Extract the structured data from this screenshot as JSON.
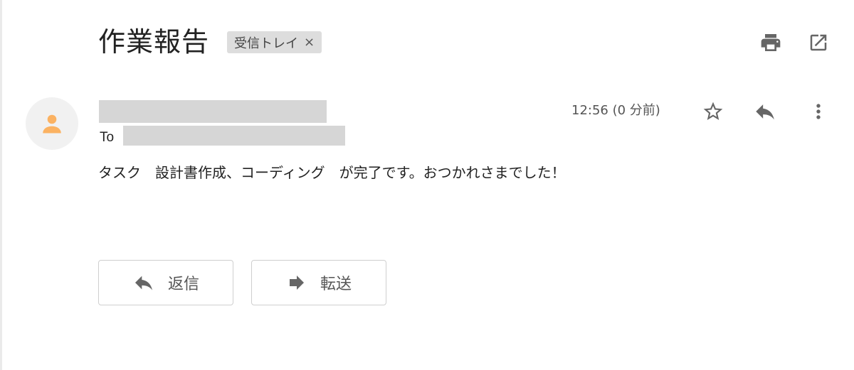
{
  "email": {
    "subject": "作業報告",
    "label": "受信トレイ",
    "label_remove": "×",
    "to_label": "To",
    "time": "12:56 (0 分前)",
    "body": "タスク　設計書作成、コーディング　が完了です。おつかれさまでした！"
  },
  "actions": {
    "reply_label": "返信",
    "forward_label": "転送"
  },
  "icons": {
    "print": "print-icon",
    "popout": "open-in-new-window-icon",
    "avatar": "person-icon",
    "star": "star-icon",
    "reply": "reply-icon",
    "more": "more-vert-icon",
    "forward": "forward-arrow-icon"
  },
  "colors": {
    "avatar_accent": "#fbb262",
    "icon_gray": "#666666",
    "redaction": "#d6d6d6"
  }
}
